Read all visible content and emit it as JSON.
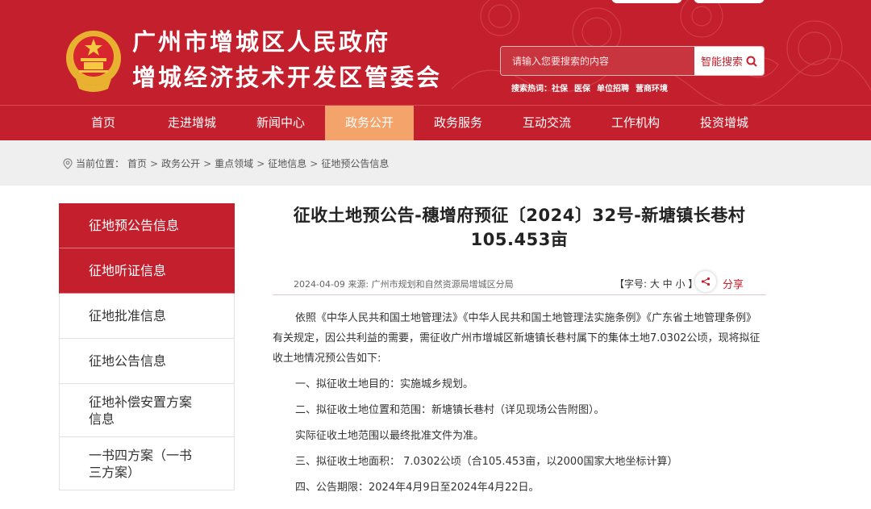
{
  "site": {
    "title_line1": "广州市增城区人民政府",
    "title_line2": "增城经济技术开发区管委会"
  },
  "search": {
    "placeholder": "请输入您要搜索的内容",
    "button": "智能搜索"
  },
  "hot": {
    "label": "搜索热词：",
    "items": [
      "社保",
      "医保",
      "单位招聘",
      "营商环境"
    ]
  },
  "nav": {
    "items": [
      "首页",
      "走进增城",
      "新闻中心",
      "政务公开",
      "政务服务",
      "互动交流",
      "工作机构",
      "投资增城"
    ],
    "active_index": 3
  },
  "breadcrumb": {
    "label": "当前位置：",
    "items": [
      "首页",
      "政务公开",
      "重点领域",
      "征地信息",
      "征地预公告信息"
    ]
  },
  "sidebar": {
    "items": [
      "征地预公告信息",
      "征地听证信息",
      "征地批准信息",
      "征地公告信息",
      "征地补偿安置方案信息",
      "一书四方案（一书三方案）"
    ]
  },
  "article": {
    "title": "征收土地预公告-穗增府预征〔2024〕32号-新塘镇长巷村105.453亩",
    "date": "2024-04-09",
    "source": "来源: 广州市规划和自然资源局增城区分局",
    "font_size": "【字号: 大 中 小 】",
    "share": "分享",
    "paragraphs": [
      "依照《中华人民共和国土地管理法》《中华人民共和国土地管理法实施条例》《广东省土地管理条例》有关规定，因公共利益的需要，需征收广州市增城区新塘镇长巷村属下的集体土地7.0302公顷，现将拟征收土地情况预公告如下:",
      "一、拟征收土地目的：实施城乡规划。",
      "二、拟征收土地位置和范围：新塘镇长巷村（详见现场公告附图）。",
      "实际征收土地范围以最终批准文件为准。",
      "三、拟征收土地面积： 7.0302公顷（合105.453亩，以2000国家大地坐标计算）",
      "四、公告期限：2024年4月9日至2024年4月22日。"
    ]
  }
}
